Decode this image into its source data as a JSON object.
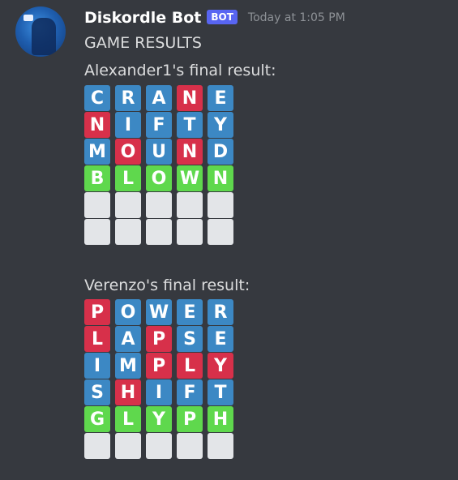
{
  "message": {
    "author": "Diskordle Bot",
    "bot_tag": "BOT",
    "timestamp": "Today at 1:05 PM",
    "title": "GAME RESULTS"
  },
  "colors": {
    "blue": "#3c88c4",
    "red": "#d7304a",
    "green": "#5fd84d",
    "empty": "#e3e5e8"
  },
  "players": [
    {
      "label": "Alexander1's final result:",
      "rows": [
        {
          "letters": [
            "C",
            "R",
            "A",
            "N",
            "E"
          ],
          "states": [
            "blue",
            "blue",
            "blue",
            "red",
            "blue"
          ]
        },
        {
          "letters": [
            "N",
            "I",
            "F",
            "T",
            "Y"
          ],
          "states": [
            "red",
            "blue",
            "blue",
            "blue",
            "blue"
          ]
        },
        {
          "letters": [
            "M",
            "O",
            "U",
            "N",
            "D"
          ],
          "states": [
            "blue",
            "red",
            "blue",
            "red",
            "blue"
          ]
        },
        {
          "letters": [
            "B",
            "L",
            "O",
            "W",
            "N"
          ],
          "states": [
            "green",
            "green",
            "green",
            "green",
            "green"
          ]
        },
        {
          "letters": [
            "",
            "",
            "",
            "",
            ""
          ],
          "states": [
            "empty",
            "empty",
            "empty",
            "empty",
            "empty"
          ]
        },
        {
          "letters": [
            "",
            "",
            "",
            "",
            ""
          ],
          "states": [
            "empty",
            "empty",
            "empty",
            "empty",
            "empty"
          ]
        }
      ]
    },
    {
      "label": "Verenzo's final result:",
      "rows": [
        {
          "letters": [
            "P",
            "O",
            "W",
            "E",
            "R"
          ],
          "states": [
            "red",
            "blue",
            "blue",
            "blue",
            "blue"
          ]
        },
        {
          "letters": [
            "L",
            "A",
            "P",
            "S",
            "E"
          ],
          "states": [
            "red",
            "blue",
            "red",
            "blue",
            "blue"
          ]
        },
        {
          "letters": [
            "I",
            "M",
            "P",
            "L",
            "Y"
          ],
          "states": [
            "blue",
            "blue",
            "red",
            "red",
            "red"
          ]
        },
        {
          "letters": [
            "S",
            "H",
            "I",
            "F",
            "T"
          ],
          "states": [
            "blue",
            "red",
            "blue",
            "blue",
            "blue"
          ]
        },
        {
          "letters": [
            "G",
            "L",
            "Y",
            "P",
            "H"
          ],
          "states": [
            "green",
            "green",
            "green",
            "green",
            "green"
          ]
        },
        {
          "letters": [
            "",
            "",
            "",
            "",
            ""
          ],
          "states": [
            "empty",
            "empty",
            "empty",
            "empty",
            "empty"
          ]
        }
      ]
    }
  ]
}
